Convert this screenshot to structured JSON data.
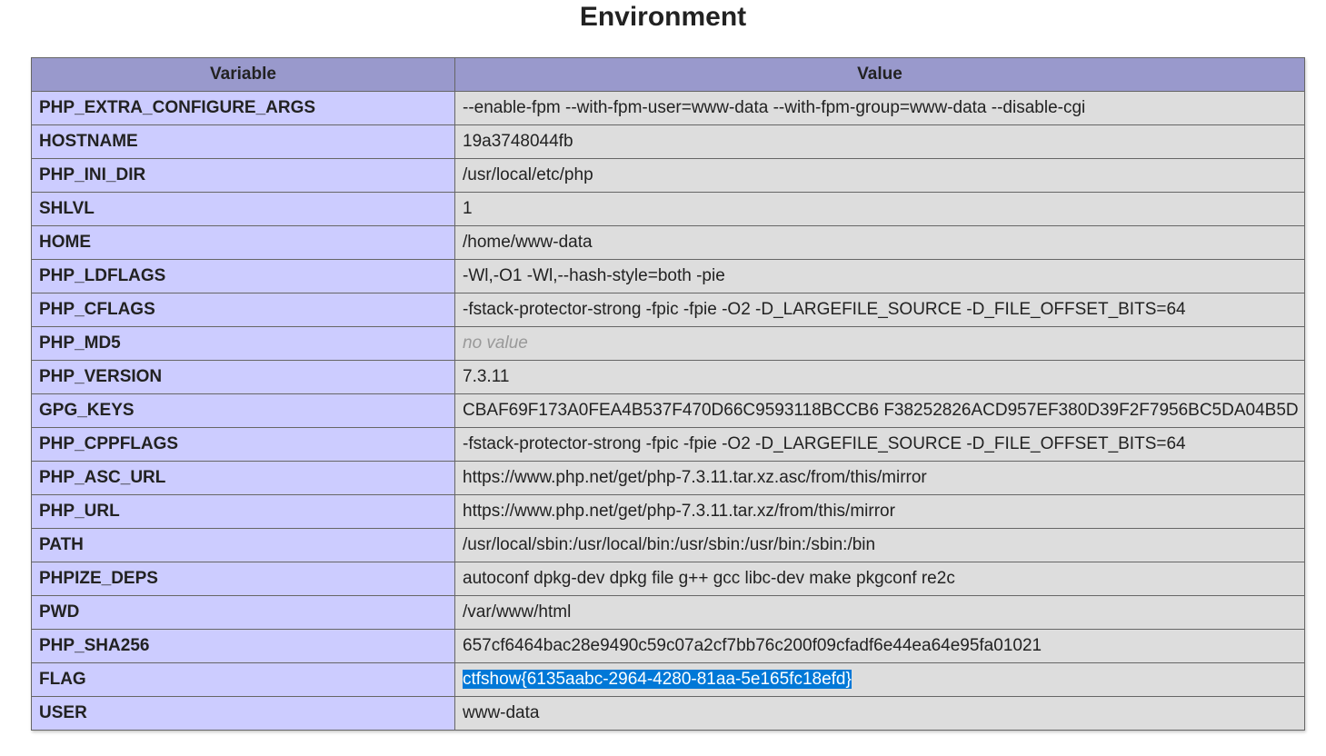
{
  "page": {
    "title": "Environment"
  },
  "table": {
    "headers": {
      "variable": "Variable",
      "value": "Value"
    },
    "rows": [
      {
        "variable": "PHP_EXTRA_CONFIGURE_ARGS",
        "value": "--enable-fpm --with-fpm-user=www-data --with-fpm-group=www-data --disable-cgi"
      },
      {
        "variable": "HOSTNAME",
        "value": "19a3748044fb"
      },
      {
        "variable": "PHP_INI_DIR",
        "value": "/usr/local/etc/php"
      },
      {
        "variable": "SHLVL",
        "value": "1"
      },
      {
        "variable": "HOME",
        "value": "/home/www-data"
      },
      {
        "variable": "PHP_LDFLAGS",
        "value": "-Wl,-O1 -Wl,--hash-style=both -pie"
      },
      {
        "variable": "PHP_CFLAGS",
        "value": "-fstack-protector-strong -fpic -fpie -O2 -D_LARGEFILE_SOURCE -D_FILE_OFFSET_BITS=64"
      },
      {
        "variable": "PHP_MD5",
        "value": "no value"
      },
      {
        "variable": "PHP_VERSION",
        "value": "7.3.11"
      },
      {
        "variable": "GPG_KEYS",
        "value": "CBAF69F173A0FEA4B537F470D66C9593118BCCB6 F38252826ACD957EF380D39F2F7956BC5DA04B5D"
      },
      {
        "variable": "PHP_CPPFLAGS",
        "value": "-fstack-protector-strong -fpic -fpie -O2 -D_LARGEFILE_SOURCE -D_FILE_OFFSET_BITS=64"
      },
      {
        "variable": "PHP_ASC_URL",
        "value": "https://www.php.net/get/php-7.3.11.tar.xz.asc/from/this/mirror"
      },
      {
        "variable": "PHP_URL",
        "value": "https://www.php.net/get/php-7.3.11.tar.xz/from/this/mirror"
      },
      {
        "variable": "PATH",
        "value": "/usr/local/sbin:/usr/local/bin:/usr/sbin:/usr/bin:/sbin:/bin"
      },
      {
        "variable": "PHPIZE_DEPS",
        "value": "autoconf dpkg-dev dpkg file g++ gcc libc-dev make pkgconf re2c"
      },
      {
        "variable": "PWD",
        "value": "/var/www/html"
      },
      {
        "variable": "PHP_SHA256",
        "value": "657cf6464bac28e9490c59c07a2cf7bb76c200f09cfadf6e44ea64e95fa01021"
      },
      {
        "variable": "FLAG",
        "value": "ctfshow{6135aabc-2964-4280-81aa-5e165fc18efd}"
      },
      {
        "variable": "USER",
        "value": "www-data"
      }
    ]
  },
  "colors": {
    "header_bg": "#9999cc",
    "variable_bg": "#ccccff",
    "value_bg": "#dddddd",
    "selection_bg": "#0078d7",
    "no_value_text": "#999999"
  }
}
